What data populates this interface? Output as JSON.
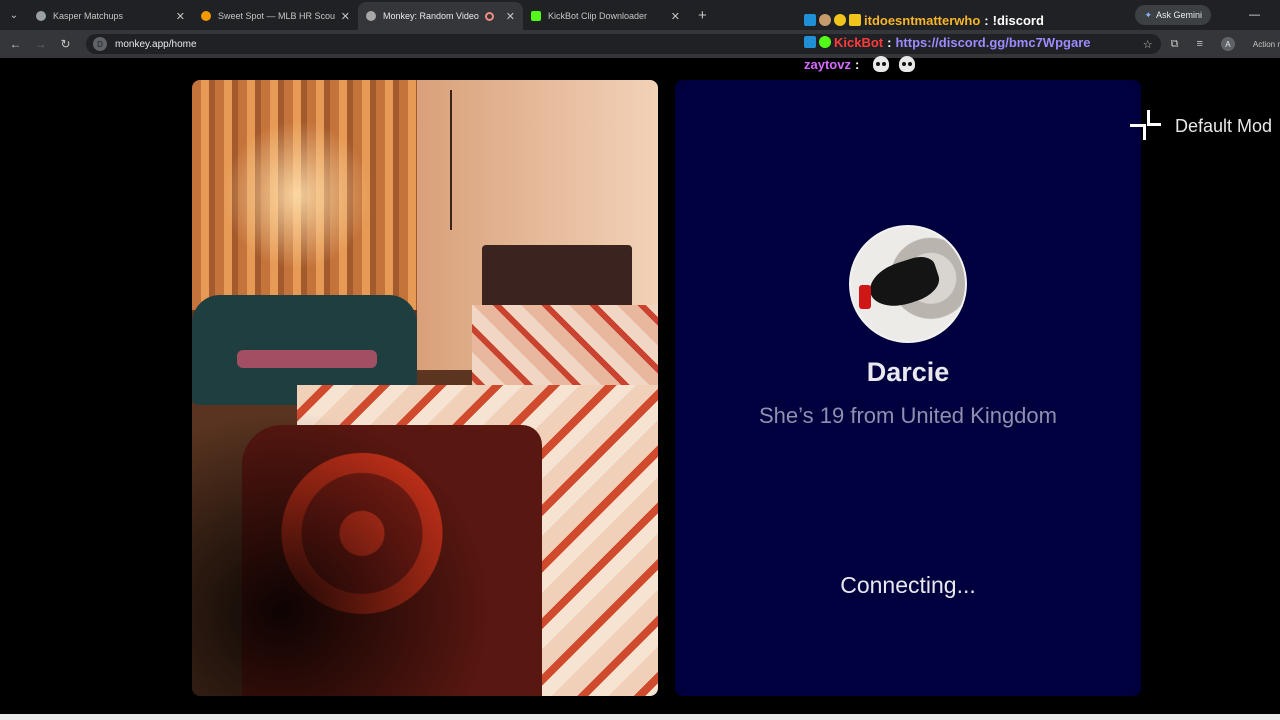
{
  "browser": {
    "tabs": [
      {
        "title": "Kasper Matchups",
        "fav_color": "#9aa0a6",
        "active": false
      },
      {
        "title": "Sweet Spot — MLB HR Scouting",
        "fav_color": "#f29900",
        "active": false
      },
      {
        "title": "Monkey: Random Video Chat",
        "fav_color": "#a7a7a7",
        "active": true,
        "recording": true
      },
      {
        "title": "KickBot Clip Downloader",
        "fav_color": "#53fc18",
        "active": false
      }
    ],
    "ask_gemini": "Ask Gemini",
    "url": "monkey.app/home",
    "site_icon": "D",
    "profile_initial": "A",
    "action_label": "Action r"
  },
  "chat": {
    "messages": [
      {
        "user": "itdoesntmatterwho",
        "text": "!discord"
      },
      {
        "user": "KickBot",
        "text": "https://discord.gg/bmc7Wpgare"
      },
      {
        "user": "zaytovz",
        "text": "skull skull"
      }
    ]
  },
  "remote_video": {
    "description": "room camera feed"
  },
  "match": {
    "name": "Darcie",
    "subtitle": "She’s 19 from United Kingdom",
    "status": "Connecting..."
  },
  "mode_button": {
    "label": "Default Mod"
  },
  "colors": {
    "panel_bg": "#00003e",
    "page_bg": "#000000",
    "kick_red": "#ff3b3b",
    "username_gold": "#f6b52b",
    "username_purple": "#d66bff",
    "link_color": "#9a8cff"
  }
}
